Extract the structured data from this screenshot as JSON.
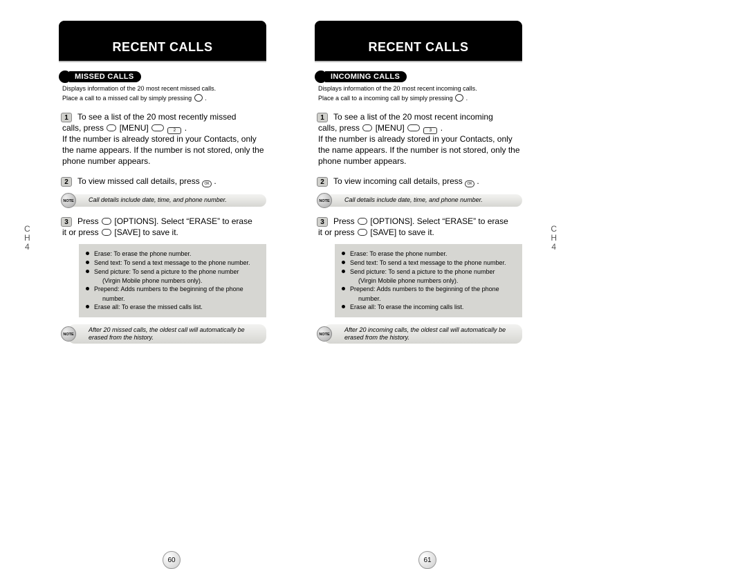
{
  "left": {
    "header": "RECENT CALLS",
    "section": "MISSED CALLS",
    "intro_l1": "Displays information of the 20 most recent missed calls.",
    "intro_l2": "Place a call to a missed call by simply pressing",
    "step1_a": "To see a list of the 20 most recently missed",
    "step1_b": "calls, press",
    "step1_menu": "[MENU]",
    "step1_c": "If the number is already stored in your Contacts, only the name appears. If the number is not stored, only the phone number appears.",
    "step2": "To view missed call details, press",
    "note1": "Call details include date, time, and phone number.",
    "step3_a": "Press",
    "step3_opts": "[OPTIONS]. Select “ERASE” to erase",
    "step3_b": "it or press",
    "step3_save": "[SAVE] to save it.",
    "opts": {
      "o1": "Erase: To erase the phone number.",
      "o2": "Send text: To send a text message to the phone number.",
      "o3": "Send picture: To send a picture to the phone number",
      "o3b": "(Virgin Mobile phone numbers only).",
      "o4": "Prepend: Adds numbers to the beginning of the phone",
      "o4b": "number.",
      "o5": "Erase all: To erase the missed calls list."
    },
    "note2": "After 20 missed calls, the oldest call will automatically be erased from the history.",
    "ch_c": "C",
    "ch_h": "H",
    "ch_n": "4",
    "key2": "2",
    "pagenum": "60"
  },
  "right": {
    "header": "RECENT CALLS",
    "section": "INCOMING CALLS",
    "intro_l1": "Displays information of the 20 most recent incoming calls.",
    "intro_l2": "Place a call to a incoming call by simply pressing",
    "step1_a": "To see a list of the 20 most recent incoming",
    "step1_b": "calls, press",
    "step1_menu": "[MENU]",
    "step1_c": "If the number is already stored in your Contacts, only the name appears. If the number is not stored, only the phone number appears.",
    "step2": "To view incoming call details, press",
    "note1": "Call details include date, time, and phone number.",
    "step3_a": "Press",
    "step3_opts": "[OPTIONS]. Select “ERASE” to erase",
    "step3_b": "it or press",
    "step3_save": "[SAVE] to save it.",
    "opts": {
      "o1": "Erase: To erase the phone number.",
      "o2": "Send text: To send a text message to the phone number.",
      "o3": "Send picture: To send a picture to the phone number",
      "o3b": "(Virgin Mobile phone numbers only).",
      "o4": "Prepend: Adds numbers to the beginning of the phone",
      "o4b": "number.",
      "o5": "Erase all: To erase the incoming calls list."
    },
    "note2": "After 20 incoming calls, the oldest call will automatically be erased from the history.",
    "ch_c": "C",
    "ch_h": "H",
    "ch_n": "4",
    "key3": "3",
    "pagenum": "61"
  },
  "labels": {
    "note": "NOTE",
    "ok": "OK"
  }
}
